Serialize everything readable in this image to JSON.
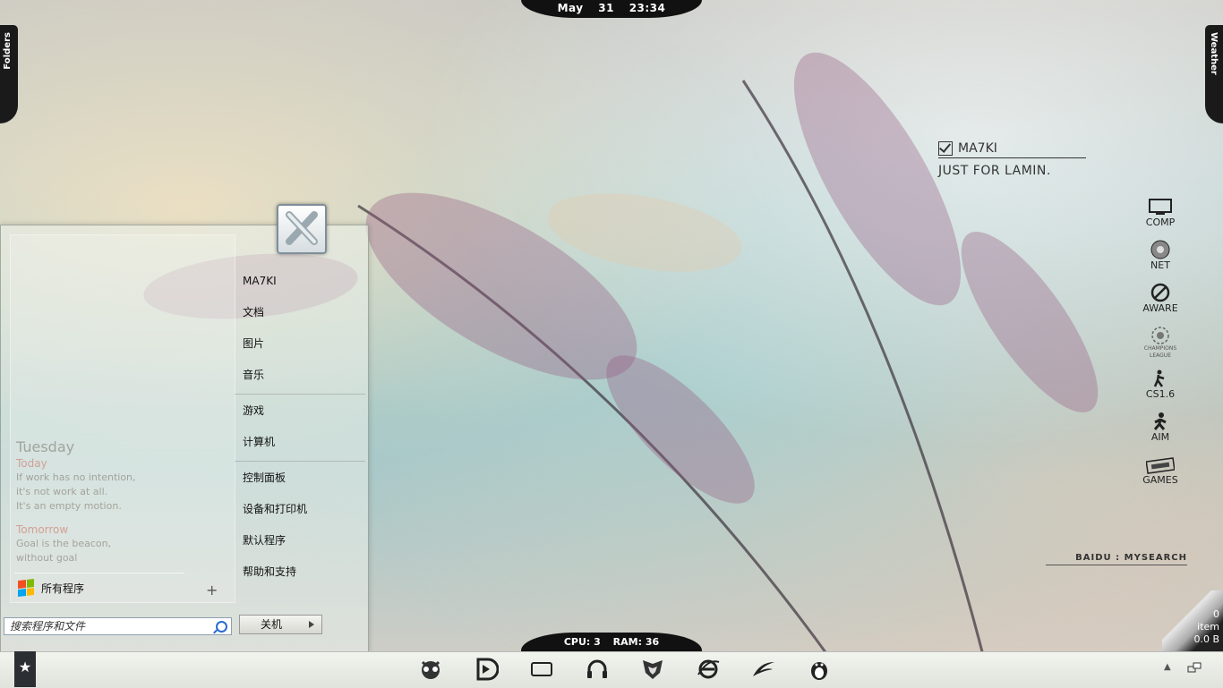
{
  "top_clock": {
    "month": "May",
    "day": "31",
    "time": "23:34"
  },
  "system_monitor": {
    "cpu": "CPU: 3",
    "ram": "RAM: 36"
  },
  "side_tabs": {
    "left": "Folders",
    "right": "Weather"
  },
  "note_widget": {
    "title": "MA7KI",
    "text": "JUST FOR LAMIN."
  },
  "launcher": [
    {
      "label": "COMP",
      "icon": "monitor-icon"
    },
    {
      "label": "NET",
      "icon": "globe-icon"
    },
    {
      "label": "AWARE",
      "icon": "no-sign-icon"
    },
    {
      "label": "CHAMPIONS LEAGUE",
      "icon": "champions-league-icon"
    },
    {
      "label": "CS1.6",
      "icon": "counter-strike-icon"
    },
    {
      "label": "AIM",
      "icon": "aim-runner-icon"
    },
    {
      "label": "GAMES",
      "icon": "ticket-icon"
    }
  ],
  "search_label": "BAIDU : MYSEARCH",
  "recycle_bin": {
    "count": "0",
    "unit": "item",
    "size": "0.0 B"
  },
  "start_menu": {
    "agenda": {
      "day": "Tuesday",
      "today_label": "Today",
      "lines": [
        "If work has no intention,",
        "it's not work at all.",
        "It's an empty motion."
      ],
      "tomorrow_label": "Tomorrow",
      "lines2": [
        "Goal is the beacon,",
        "without goal"
      ]
    },
    "all_programs": "所有程序",
    "search_placeholder": "搜索程序和文件",
    "shutdown_label": "关机",
    "right_items": {
      "user": "MA7KI",
      "documents": "文档",
      "pictures": "图片",
      "music": "音乐",
      "games": "游戏",
      "computer": "计算机",
      "control_panel": "控制面板",
      "devices_printers": "设备和打印机",
      "default_programs": "默认程序",
      "help_support": "帮助和支持"
    }
  },
  "taskbar": {
    "start_icon": "star-icon",
    "pinned": [
      "raccoon-icon",
      "play-icon",
      "window-icon",
      "headphones-icon",
      "decepticon-icon",
      "ie-icon",
      "bird-icon",
      "penguin-icon"
    ]
  }
}
